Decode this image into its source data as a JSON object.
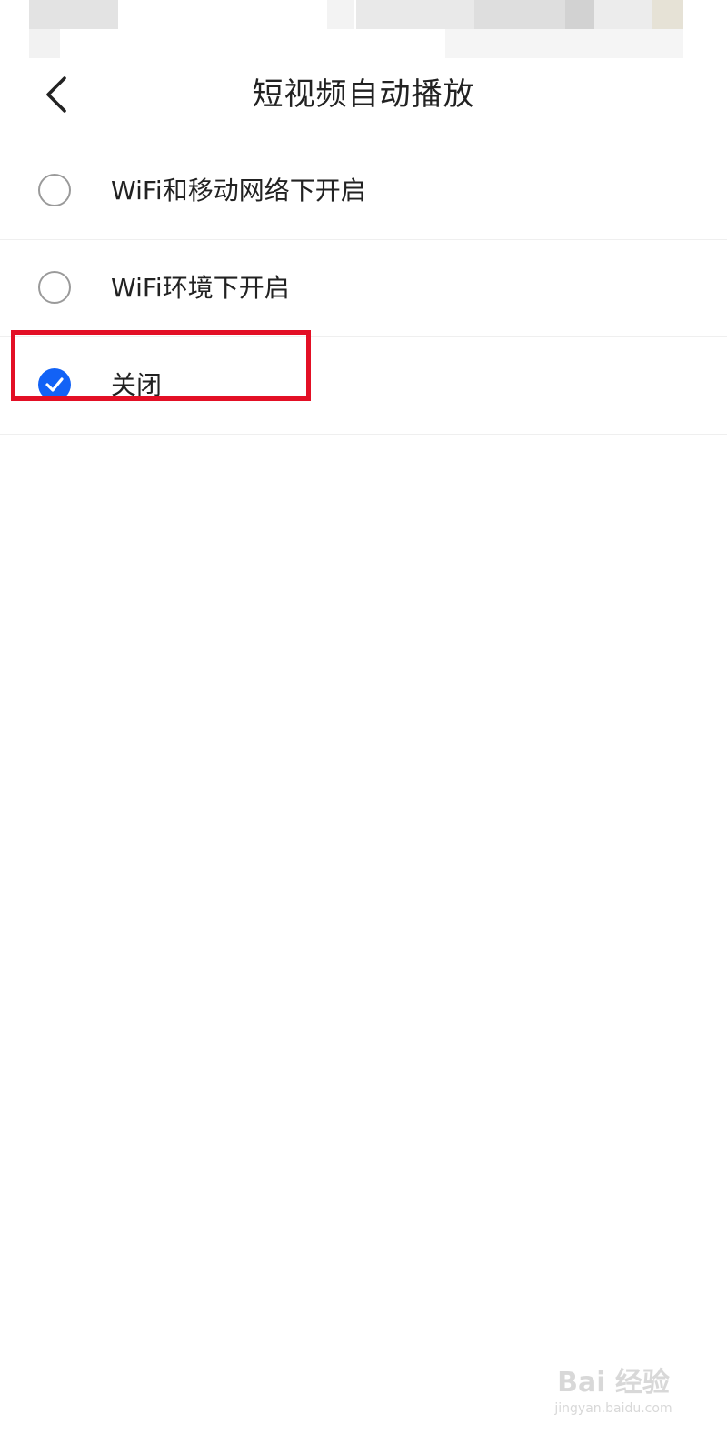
{
  "header": {
    "title": "短视频自动播放",
    "back_icon": "chevron-left-icon"
  },
  "options": [
    {
      "label": "WiFi和移动网络下开启",
      "selected": false
    },
    {
      "label": "WiFi环境下开启",
      "selected": false
    },
    {
      "label": "关闭",
      "selected": true
    }
  ],
  "colors": {
    "accent": "#1262f6",
    "highlight_border": "#e30f25",
    "text": "#222222",
    "radio_border": "#9a9a9a"
  },
  "watermark": {
    "main": "Bai 经验",
    "sub": "jingyan.baidu.com"
  }
}
